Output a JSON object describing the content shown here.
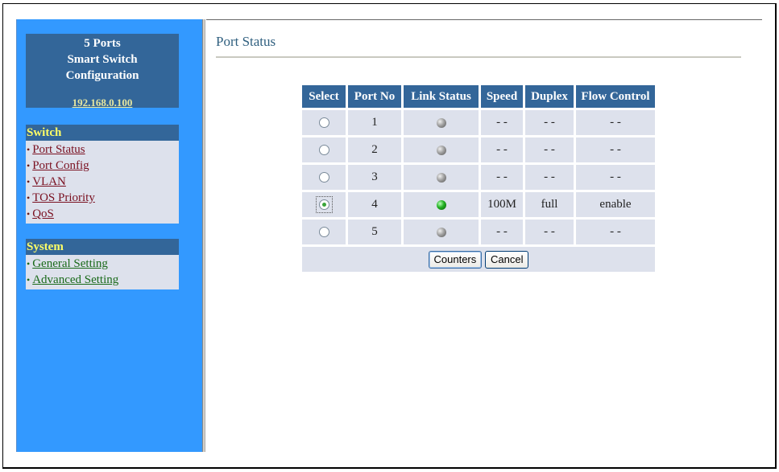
{
  "sidebar": {
    "brand": {
      "line1": "5 Ports",
      "line2": "Smart Switch",
      "line3": "Configuration",
      "ip_link": "192.168.0.100"
    },
    "sections": [
      {
        "title": "Switch",
        "items": [
          {
            "label": "Port Status"
          },
          {
            "label": "Port Config"
          },
          {
            "label": "VLAN"
          },
          {
            "label": "TOS Priority"
          },
          {
            "label": "QoS"
          }
        ]
      },
      {
        "title": "System",
        "items": [
          {
            "label": "General Setting"
          },
          {
            "label": "Advanced Setting"
          }
        ]
      }
    ],
    "bullet": "•"
  },
  "main": {
    "title": "Port Status",
    "table": {
      "headers": [
        "Select",
        "Port No",
        "Link Status",
        "Speed",
        "Duplex",
        "Flow Control"
      ],
      "rows": [
        {
          "selected": false,
          "port": "1",
          "link": "down",
          "speed": "- -",
          "duplex": "- -",
          "flow": "- -"
        },
        {
          "selected": false,
          "port": "2",
          "link": "down",
          "speed": "- -",
          "duplex": "- -",
          "flow": "- -"
        },
        {
          "selected": false,
          "port": "3",
          "link": "down",
          "speed": "- -",
          "duplex": "- -",
          "flow": "- -"
        },
        {
          "selected": true,
          "port": "4",
          "link": "up",
          "speed": "100M",
          "duplex": "full",
          "flow": "enable"
        },
        {
          "selected": false,
          "port": "5",
          "link": "down",
          "speed": "- -",
          "duplex": "- -",
          "flow": "- -"
        }
      ]
    },
    "buttons": {
      "counters": "Counters",
      "cancel": "Cancel"
    }
  },
  "colors": {
    "sidebar_bg": "#3399ff",
    "header_bg": "#336699",
    "menu_header_text": "#ffff66",
    "cell_bg": "#dde1ec",
    "link_up": "#22b022",
    "link_down": "#a0a0a0"
  }
}
